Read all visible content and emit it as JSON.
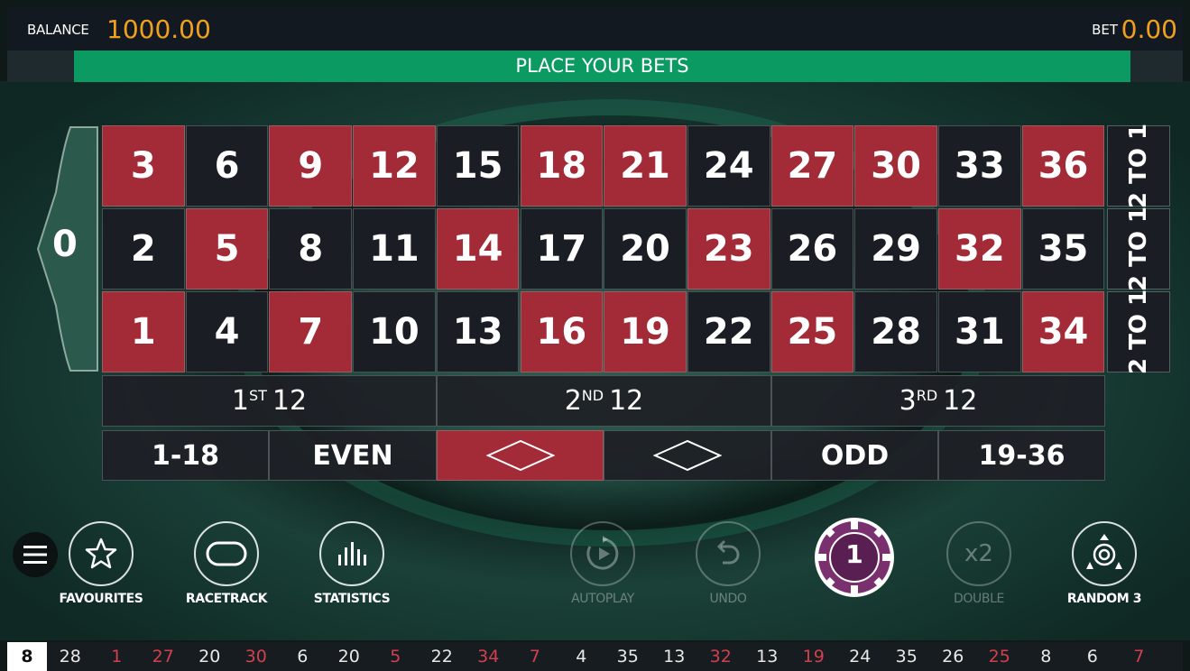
{
  "header": {
    "balance_label": "BALANCE",
    "balance_value": "1000.00",
    "bet_label": "BET",
    "bet_value": "0.00"
  },
  "status_text": "PLACE YOUR BETS",
  "colors": {
    "red": "#a32a37",
    "black": "#1b1d24",
    "accent": "#f0a020",
    "status_green": "#0c9a63"
  },
  "table": {
    "zero": "0",
    "rows": [
      [
        {
          "n": "3",
          "c": "red"
        },
        {
          "n": "6",
          "c": "black"
        },
        {
          "n": "9",
          "c": "red"
        },
        {
          "n": "12",
          "c": "red"
        },
        {
          "n": "15",
          "c": "black"
        },
        {
          "n": "18",
          "c": "red"
        },
        {
          "n": "21",
          "c": "red"
        },
        {
          "n": "24",
          "c": "black"
        },
        {
          "n": "27",
          "c": "red"
        },
        {
          "n": "30",
          "c": "red"
        },
        {
          "n": "33",
          "c": "black"
        },
        {
          "n": "36",
          "c": "red"
        }
      ],
      [
        {
          "n": "2",
          "c": "black"
        },
        {
          "n": "5",
          "c": "red"
        },
        {
          "n": "8",
          "c": "black"
        },
        {
          "n": "11",
          "c": "black"
        },
        {
          "n": "14",
          "c": "red"
        },
        {
          "n": "17",
          "c": "black"
        },
        {
          "n": "20",
          "c": "black"
        },
        {
          "n": "23",
          "c": "red"
        },
        {
          "n": "26",
          "c": "black"
        },
        {
          "n": "29",
          "c": "black"
        },
        {
          "n": "32",
          "c": "red"
        },
        {
          "n": "35",
          "c": "black"
        }
      ],
      [
        {
          "n": "1",
          "c": "red"
        },
        {
          "n": "4",
          "c": "black"
        },
        {
          "n": "7",
          "c": "red"
        },
        {
          "n": "10",
          "c": "black"
        },
        {
          "n": "13",
          "c": "black"
        },
        {
          "n": "16",
          "c": "red"
        },
        {
          "n": "19",
          "c": "red"
        },
        {
          "n": "22",
          "c": "black"
        },
        {
          "n": "25",
          "c": "red"
        },
        {
          "n": "28",
          "c": "black"
        },
        {
          "n": "31",
          "c": "black"
        },
        {
          "n": "34",
          "c": "red"
        }
      ]
    ],
    "column_bet_label": "2 TO 1",
    "dozens": [
      {
        "pre": "1",
        "sup": "ST",
        "post": "12"
      },
      {
        "pre": "2",
        "sup": "ND",
        "post": "12"
      },
      {
        "pre": "3",
        "sup": "RD",
        "post": "12"
      }
    ],
    "outside": {
      "low": "1-18",
      "even": "EVEN",
      "odd": "ODD",
      "high": "19-36"
    }
  },
  "controls": {
    "favourites": "FAVOURITES",
    "racetrack": "RACETRACK",
    "statistics": "STATISTICS",
    "autoplay": "AUTOPLAY",
    "undo": "UNDO",
    "chip_value": "1",
    "double_icon": "x2",
    "double": "DOUBLE",
    "random": "RANDOM 3"
  },
  "history": [
    {
      "n": "8",
      "c": "current"
    },
    {
      "n": "28",
      "c": "black"
    },
    {
      "n": "1",
      "c": "red"
    },
    {
      "n": "27",
      "c": "red"
    },
    {
      "n": "20",
      "c": "black"
    },
    {
      "n": "30",
      "c": "red"
    },
    {
      "n": "6",
      "c": "black"
    },
    {
      "n": "20",
      "c": "black"
    },
    {
      "n": "5",
      "c": "red"
    },
    {
      "n": "22",
      "c": "black"
    },
    {
      "n": "34",
      "c": "red"
    },
    {
      "n": "7",
      "c": "red"
    },
    {
      "n": "4",
      "c": "black"
    },
    {
      "n": "35",
      "c": "black"
    },
    {
      "n": "13",
      "c": "black"
    },
    {
      "n": "32",
      "c": "red"
    },
    {
      "n": "13",
      "c": "black"
    },
    {
      "n": "19",
      "c": "red"
    },
    {
      "n": "24",
      "c": "black"
    },
    {
      "n": "35",
      "c": "black"
    },
    {
      "n": "26",
      "c": "black"
    },
    {
      "n": "25",
      "c": "red"
    },
    {
      "n": "8",
      "c": "black"
    },
    {
      "n": "6",
      "c": "black"
    },
    {
      "n": "7",
      "c": "red"
    }
  ]
}
